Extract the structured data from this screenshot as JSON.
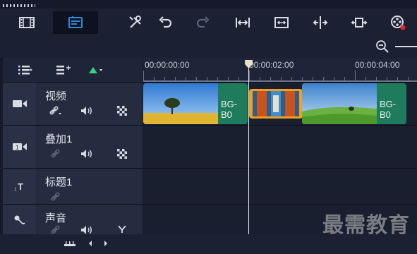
{
  "toolbar": {
    "buttons": [
      {
        "name": "storyboard-view-button",
        "icon": "film-strip-icon"
      },
      {
        "name": "timeline-view-button",
        "icon": "timeline-icon",
        "selected": true
      },
      {
        "name": "tools-button",
        "icon": "tools-icon"
      },
      {
        "name": "undo-button",
        "icon": "undo-icon"
      },
      {
        "name": "redo-button",
        "icon": "redo-icon"
      },
      {
        "name": "fit-width-button",
        "icon": "fit-width-icon"
      },
      {
        "name": "fit-screen-button",
        "icon": "fit-screen-icon"
      },
      {
        "name": "split-button",
        "icon": "split-icon"
      },
      {
        "name": "expand-button",
        "icon": "expand-icon"
      },
      {
        "name": "record-button",
        "icon": "film-reel-record-icon"
      }
    ]
  },
  "zoom": {
    "icon": "zoom-out-icon"
  },
  "ruler": {
    "labels": [
      "00:00:00:00",
      "00:00:02:00",
      "00:00:04:00"
    ]
  },
  "tracks": [
    {
      "name": "视频",
      "type": "video"
    },
    {
      "name": "叠加1",
      "type": "overlay"
    },
    {
      "name": "标题1",
      "type": "title"
    },
    {
      "name": "声音",
      "type": "audio"
    }
  ],
  "clips": [
    {
      "label": "BG-B0"
    },
    {
      "label": ""
    },
    {
      "label": "BG-B0"
    }
  ],
  "watermark": "最需教育",
  "colors": {
    "accent": "#2a8cd6",
    "clip_green": "#1e7c5d",
    "clip_orange": "#f0a020"
  }
}
